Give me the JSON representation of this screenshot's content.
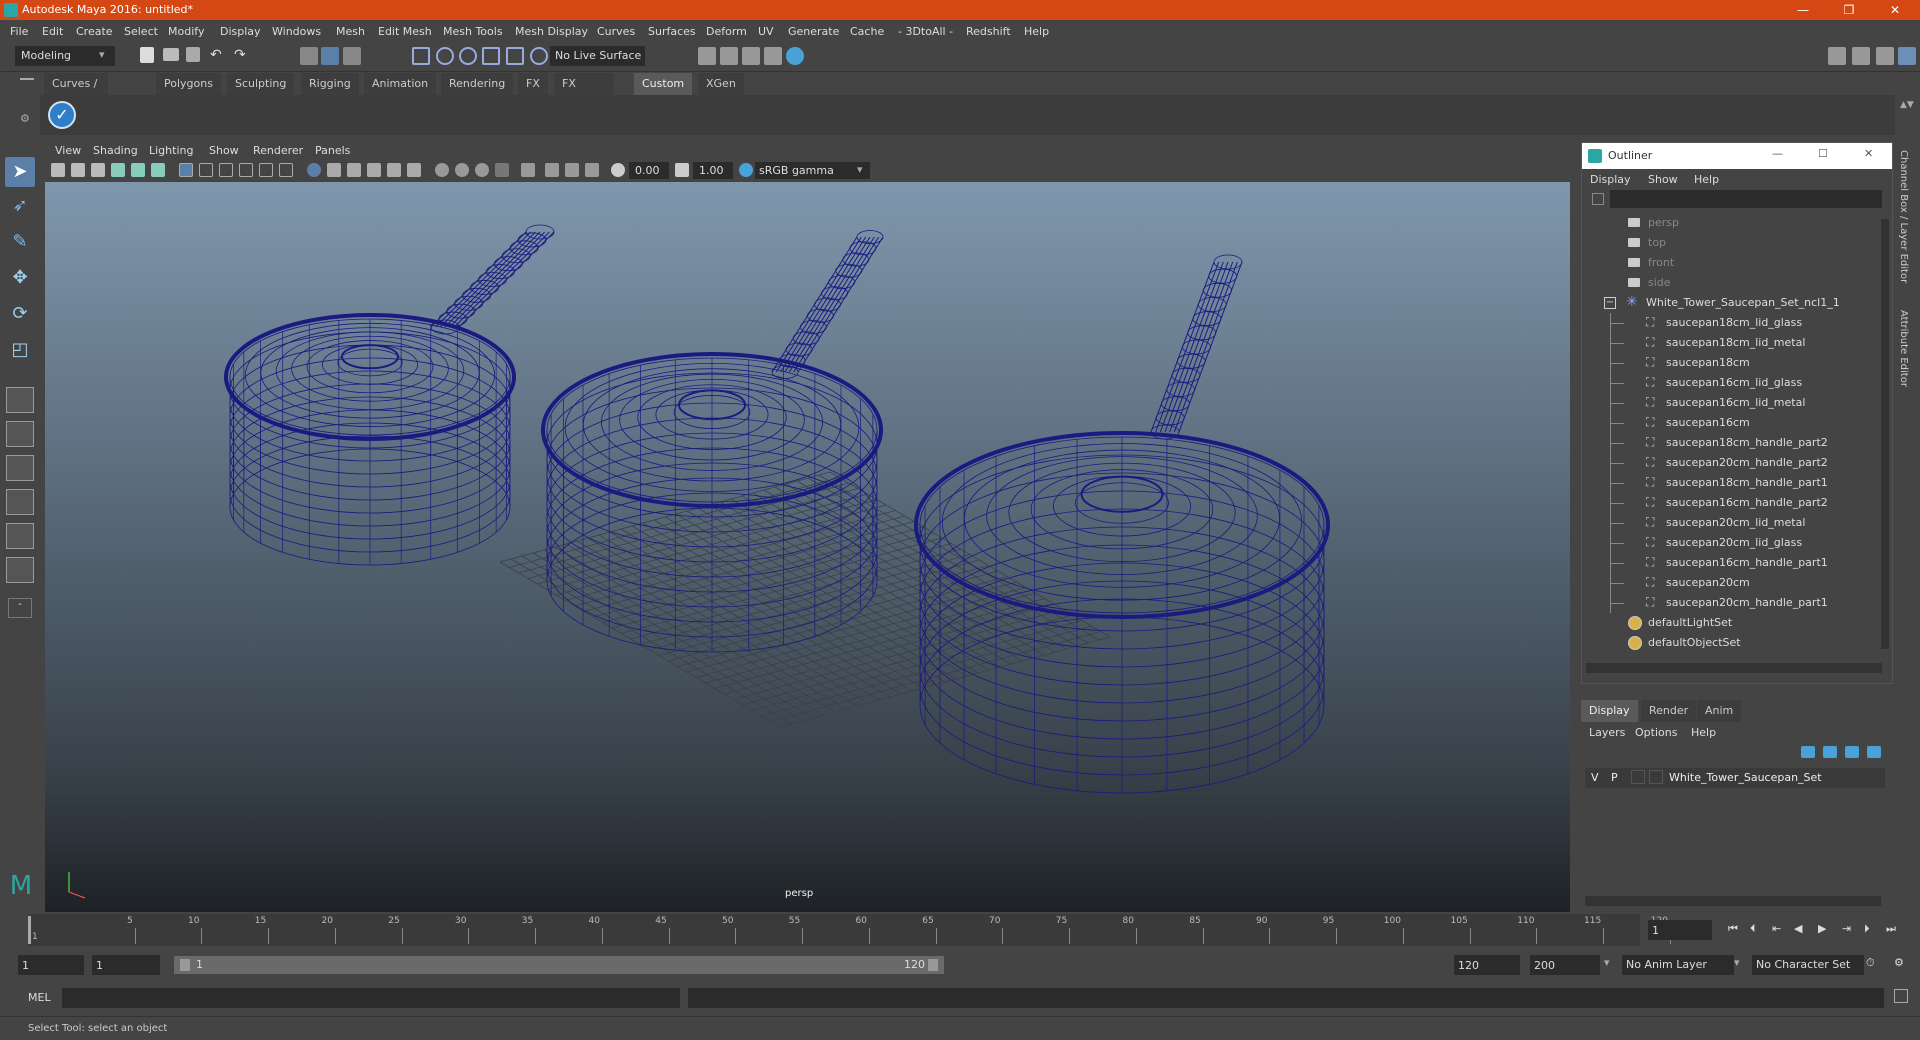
{
  "window": {
    "title": "Autodesk Maya 2016: untitled*",
    "minimize": "—",
    "maximize": "❐",
    "close": "✕"
  },
  "menubar": [
    "File",
    "Edit",
    "Create",
    "Select",
    "Modify",
    "Display",
    "Windows",
    "Mesh",
    "Edit Mesh",
    "Mesh Tools",
    "Mesh Display",
    "Curves",
    "Surfaces",
    "Deform",
    "UV",
    "Generate",
    "Cache",
    "- 3DtoAll -",
    "Redshift",
    "Help"
  ],
  "toolbar": {
    "mode": "Modeling",
    "live_surface": "No Live Surface"
  },
  "shelf_tabs": [
    "Curves / Surfaces",
    "Polygons",
    "Sculpting",
    "Rigging",
    "Animation",
    "Rendering",
    "FX",
    "FX Caching",
    "Custom",
    "XGen"
  ],
  "shelf_active": "Custom",
  "viewport": {
    "menus": [
      "View",
      "Shading",
      "Lighting",
      "Show",
      "Renderer",
      "Panels"
    ],
    "exposure": "0.00",
    "gamma": "1.00",
    "colorspace": "sRGB gamma",
    "camera_label": "persp",
    "wire_color": "#1a1a80"
  },
  "outliner": {
    "title": "Outliner",
    "menus": [
      "Display",
      "Show",
      "Help"
    ],
    "cameras": [
      "persp",
      "top",
      "front",
      "side"
    ],
    "group": "White_Tower_Saucepan_Set_ncl1_1",
    "children": [
      "saucepan18cm_lid_glass",
      "saucepan18cm_lid_metal",
      "saucepan18cm",
      "saucepan16cm_lid_glass",
      "saucepan16cm_lid_metal",
      "saucepan16cm",
      "saucepan18cm_handle_part2",
      "saucepan20cm_handle_part2",
      "saucepan18cm_handle_part1",
      "saucepan16cm_handle_part2",
      "saucepan20cm_lid_metal",
      "saucepan20cm_lid_glass",
      "saucepan16cm_handle_part1",
      "saucepan20cm",
      "saucepan20cm_handle_part1"
    ],
    "sets": [
      "defaultLightSet",
      "defaultObjectSet"
    ]
  },
  "layers": {
    "tabs": [
      "Display",
      "Render",
      "Anim"
    ],
    "active_tab": "Display",
    "menus": [
      "Layers",
      "Options",
      "Help"
    ],
    "row": {
      "v": "V",
      "p": "P",
      "name": "White_Tower_Saucepan_Set"
    }
  },
  "timeline": {
    "ticks": [
      "5",
      "10",
      "15",
      "20",
      "25",
      "30",
      "35",
      "40",
      "45",
      "50",
      "55",
      "60",
      "65",
      "70",
      "75",
      "80",
      "85",
      "90",
      "95",
      "100",
      "105",
      "110",
      "115",
      "120"
    ],
    "first_tick": "1",
    "current_frame": "1"
  },
  "range": {
    "start": "1",
    "playback_start": "1",
    "slider_start": "1",
    "slider_end": "120",
    "playback_end": "120",
    "end": "200",
    "anim_layer": "No Anim Layer",
    "character_set": "No Character Set"
  },
  "mel": {
    "label": "MEL"
  },
  "help_line": "Select Tool: select an object",
  "side_tabs": [
    "Channel Box / Layer Editor",
    "Attribute Editor"
  ]
}
